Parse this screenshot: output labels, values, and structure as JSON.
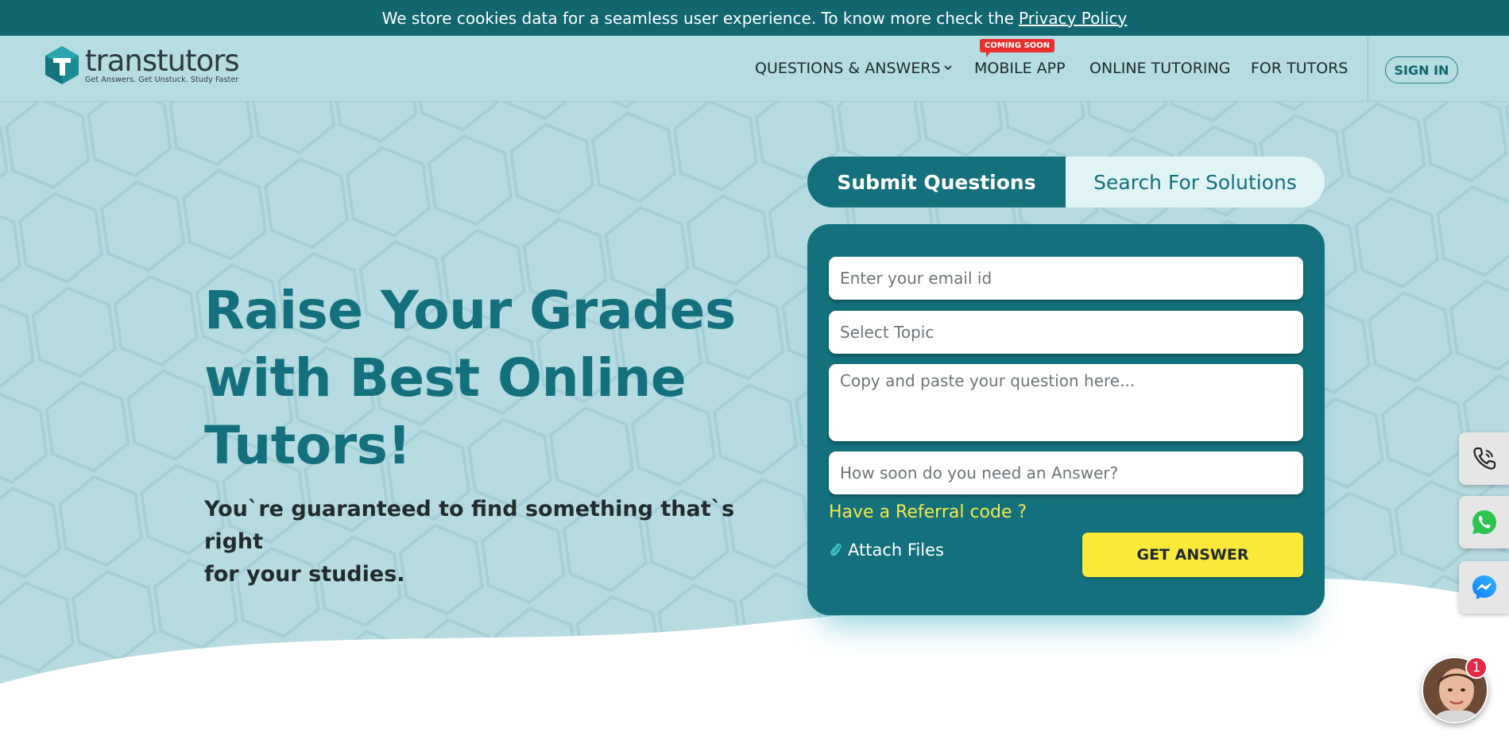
{
  "cookie_bar": {
    "message": "We store cookies data for a seamless user experience. To know more check the",
    "link_label": "Privacy Policy"
  },
  "logo": {
    "name": "transtutors",
    "tagline": "Get Answers. Get Unstuck. Study Faster",
    "icon": "transtutors-logo-icon"
  },
  "nav": {
    "items": [
      {
        "label": "QUESTIONS & ANSWERS",
        "has_dropdown": true
      },
      {
        "label": "MOBILE APP",
        "badge": "COMING SOON"
      },
      {
        "label": "ONLINE TUTORING"
      },
      {
        "label": "FOR TUTORS"
      }
    ],
    "signin_label": "SIGN IN"
  },
  "hero": {
    "headline_1": "Raise Your Grades",
    "headline_2": "with Best Online",
    "headline_3": "Tutors!",
    "subline_1": "You`re guaranteed to find something that`s right",
    "subline_2": "for your studies."
  },
  "tabs": {
    "active": "Submit Questions",
    "inactive": "Search For Solutions"
  },
  "form": {
    "email_placeholder": "Enter your email id",
    "topic_placeholder": "Select Topic",
    "question_placeholder": "Copy and paste your question here...",
    "deadline_placeholder": "How soon do you need an Answer?",
    "referral_label": "Have a Referral code ?",
    "attach_label": "Attach Files",
    "submit_label": "GET ANSWER"
  },
  "side_buttons": [
    "phone-icon",
    "whatsapp-icon",
    "messenger-icon"
  ],
  "chat": {
    "unread_count": "1"
  },
  "colors": {
    "brand_teal": "#13707c",
    "cookie_bar": "#11666f",
    "hero_bg": "#b6dce2",
    "cta_yellow": "#fbe93a",
    "referral_yellow": "#f6e94a",
    "badge_red": "#e8312f"
  }
}
